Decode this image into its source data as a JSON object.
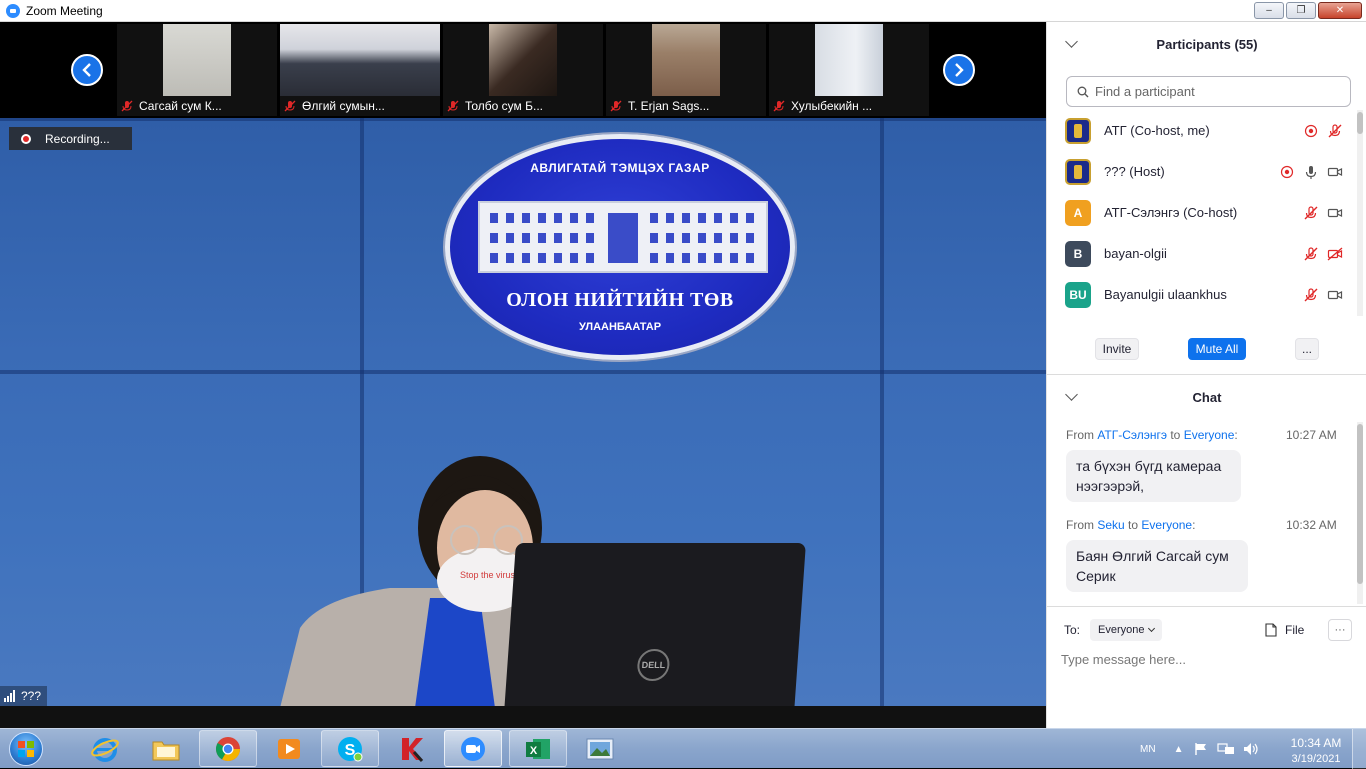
{
  "window": {
    "title": "Zoom Meeting"
  },
  "thumbnails": [
    {
      "label": "Сагсай сум К..."
    },
    {
      "label": "Өлгий сумын..."
    },
    {
      "label": "Толбо сум Б..."
    },
    {
      "label": "T. Erjan Sags..."
    },
    {
      "label": "Хулыбекийн ..."
    }
  ],
  "recording": {
    "label": "Recording..."
  },
  "main_video": {
    "speaker_label": "???",
    "emblem_top": "АВЛИГАТАЙ ТЭМЦЭХ ГАЗАР",
    "emblem_main": "ОЛОН НИЙТИЙН ТӨВ",
    "emblem_city": "УЛААНБААТАР",
    "laptop_logo": "DELL"
  },
  "participants": {
    "title": "Participants (55)",
    "search_placeholder": "Find a participant",
    "list": [
      {
        "name": "АТГ (Co-host, me)",
        "avatar": "",
        "avatar_color": "#1b2a8a",
        "recording": true,
        "mic": "muted",
        "video": "none"
      },
      {
        "name": "??? (Host)",
        "avatar": "",
        "avatar_color": "#1b2a8a",
        "recording": true,
        "mic": "on",
        "video": "on"
      },
      {
        "name": "АТГ-Сэлэнгэ (Co-host)",
        "avatar": "A",
        "avatar_color": "#f0a020",
        "recording": false,
        "mic": "muted",
        "video": "on"
      },
      {
        "name": "bayan-olgii",
        "avatar": "B",
        "avatar_color": "#3d4a5c",
        "recording": false,
        "mic": "muted",
        "video": "off"
      },
      {
        "name": "Bayanulgii ulaankhus",
        "avatar": "BU",
        "avatar_color": "#1aa38a",
        "recording": false,
        "mic": "muted",
        "video": "on"
      }
    ],
    "invite_label": "Invite",
    "mute_all_label": "Mute All",
    "more_label": "..."
  },
  "chat": {
    "title": "Chat",
    "messages": [
      {
        "from_prefix": "From ",
        "sender": "АТГ-Сэлэнгэ",
        "to_word": " to ",
        "recipient": "Everyone",
        "suffix": ":",
        "time": "10:27 AM",
        "line1": "та бүхэн бүгд камераа",
        "line2": "нээгээрэй,"
      },
      {
        "from_prefix": "From ",
        "sender": "Seku",
        "to_word": " to ",
        "recipient": "Everyone",
        "suffix": ":",
        "time": "10:32 AM",
        "line1": "Баян Өлгий Сагсай сум",
        "line2": "Серик"
      }
    ],
    "to_label": "To:",
    "to_value": "Everyone",
    "file_label": "File",
    "more_label": "···",
    "input_placeholder": "Type message here..."
  },
  "taskbar": {
    "language": "MN",
    "time": "10:34 AM",
    "date": "3/19/2021"
  },
  "colors": {
    "accent": "#0e72ed",
    "zoom_blue": "#2d8cff",
    "muted_red": "#e02828"
  }
}
